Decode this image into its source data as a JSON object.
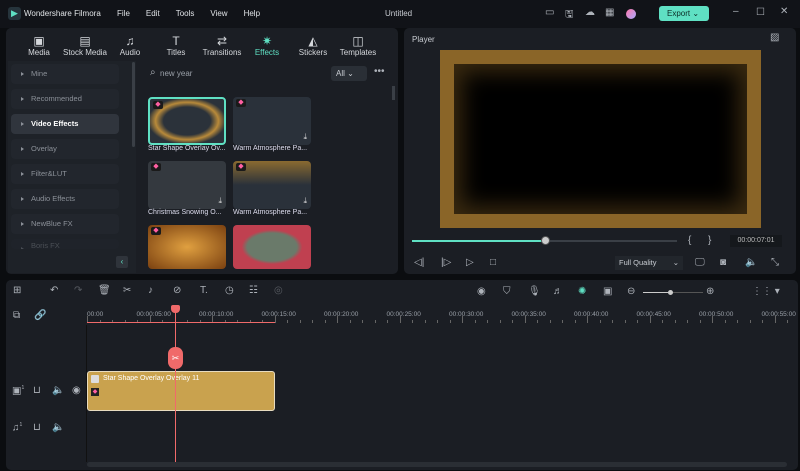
{
  "app": {
    "name": "Wondershare Filmora",
    "title": "Untitled",
    "menu": [
      "File",
      "Edit",
      "Tools",
      "View",
      "Help"
    ],
    "export_label": "Export"
  },
  "tabs": [
    {
      "label": "Media"
    },
    {
      "label": "Stock Media"
    },
    {
      "label": "Audio"
    },
    {
      "label": "Titles"
    },
    {
      "label": "Transitions"
    },
    {
      "label": "Effects",
      "active": true
    },
    {
      "label": "Stickers"
    },
    {
      "label": "Templates"
    }
  ],
  "sidebar": {
    "items": [
      "Mine",
      "Recommended",
      "Video Effects",
      "Overlay",
      "Filter&LUT",
      "Audio Effects",
      "NewBlue FX",
      "Boris FX"
    ],
    "active": "Video Effects"
  },
  "search": {
    "value": "new year",
    "filter": "All"
  },
  "effects": [
    "Star Shape Overlay Ov...",
    "Warm Atmosphere Pa...",
    "Christmas Snowing O...",
    "Warm Atmosphere Pa...",
    "",
    ""
  ],
  "player": {
    "label": "Player",
    "timecode": "00:00:07:01",
    "quality": "Full Quality",
    "progress": 0.5
  },
  "timeline": {
    "ruler": [
      "00:00",
      "00:00:05:00",
      "00:00:10:00",
      "00:00:15:00",
      "00:00:20:00",
      "00:00:25:00",
      "00:00:30:00",
      "00:00:35:00",
      "00:00:40:00",
      "00:00:45:00",
      "00:00:50:00",
      "00:00:55:00"
    ],
    "clip": "Star Shape Overlay Overlay 11",
    "video_track": "1",
    "audio_track": "1"
  },
  "colors": {
    "accent": "#5fe0c3",
    "playhead": "#f06a6a",
    "clip": "#c9a24e"
  }
}
